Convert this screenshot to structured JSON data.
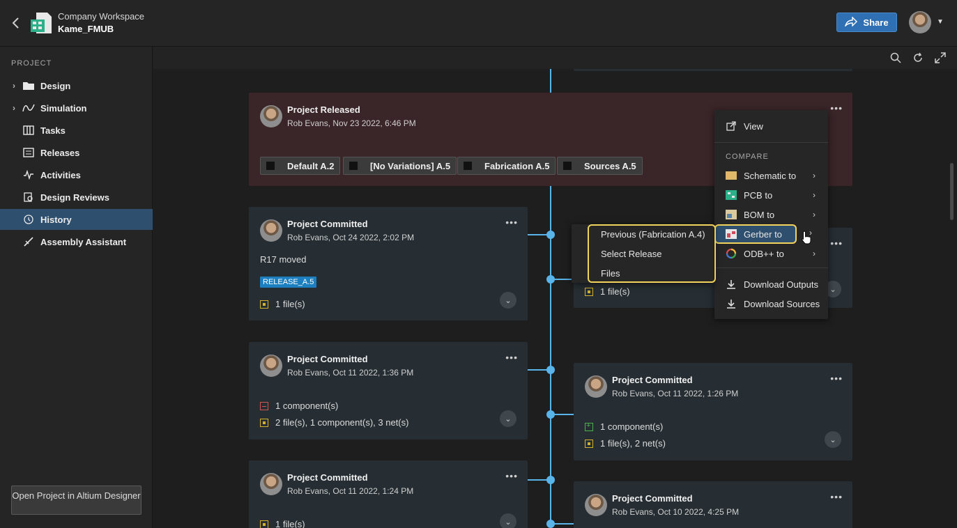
{
  "header": {
    "workspace": "Company Workspace",
    "project": "Kame_FMUB",
    "share_label": "Share"
  },
  "sidebar": {
    "heading": "PROJECT",
    "items": [
      {
        "label": "Design",
        "icon": "folder-icon",
        "expandable": true
      },
      {
        "label": "Simulation",
        "icon": "simulation-icon",
        "expandable": true
      },
      {
        "label": "Tasks",
        "icon": "tasks-icon"
      },
      {
        "label": "Releases",
        "icon": "releases-icon"
      },
      {
        "label": "Activities",
        "icon": "activity-icon"
      },
      {
        "label": "Design Reviews",
        "icon": "design-review-icon"
      },
      {
        "label": "History",
        "icon": "history-icon",
        "active": true
      },
      {
        "label": "Assembly Assistant",
        "icon": "assembly-icon"
      }
    ],
    "open_button": "Open Project in Altium Designer"
  },
  "history": {
    "released": {
      "title": "Project Released",
      "subtitle": "Rob Evans, Nov 23 2022, 6:46 PM",
      "chips": [
        "Default A.2",
        "[No Variations] A.5",
        "Fabrication A.5",
        "Sources A.5"
      ]
    },
    "left_cards": [
      {
        "title": "Project Committed",
        "subtitle": "Rob Evans, Oct 24 2022, 2:02 PM",
        "note": "R17 moved",
        "tag": "RELEASE_A.5",
        "lines": [
          "1 file(s)"
        ]
      },
      {
        "title": "Project Committed",
        "subtitle": "Rob Evans, Oct 11 2022, 1:36 PM",
        "lines": [
          "1 component(s)",
          "2 file(s), 1 component(s), 3 net(s)"
        ]
      },
      {
        "title": "Project Committed",
        "subtitle": "Rob Evans, Oct 11 2022, 1:24 PM",
        "lines": [
          "1 file(s)"
        ]
      }
    ],
    "right_cards": [
      {
        "lines": [
          "1 file(s)"
        ]
      },
      {
        "title": "Project Committed",
        "subtitle": "Rob Evans, Oct 11 2022, 1:26 PM",
        "lines": [
          "1 component(s)",
          "1 file(s), 2 net(s)"
        ]
      },
      {
        "title": "Project Committed",
        "subtitle": "Rob Evans, Oct 10 2022, 4:25 PM"
      }
    ]
  },
  "context_menu": {
    "view": "View",
    "compare_heading": "COMPARE",
    "compare_items": [
      "Schematic to",
      "PCB to",
      "BOM to",
      "Gerber to",
      "ODB++ to"
    ],
    "download_items": [
      "Download Outputs",
      "Download Sources"
    ]
  },
  "submenu": {
    "items": [
      "Previous (Fabrication A.4)",
      "Select Release",
      "Files"
    ]
  },
  "colors": {
    "accent": "#2f6fb3",
    "timeline": "#59b4ea",
    "highlight": "#f2d45c",
    "active_nav": "#2e4f6d"
  }
}
